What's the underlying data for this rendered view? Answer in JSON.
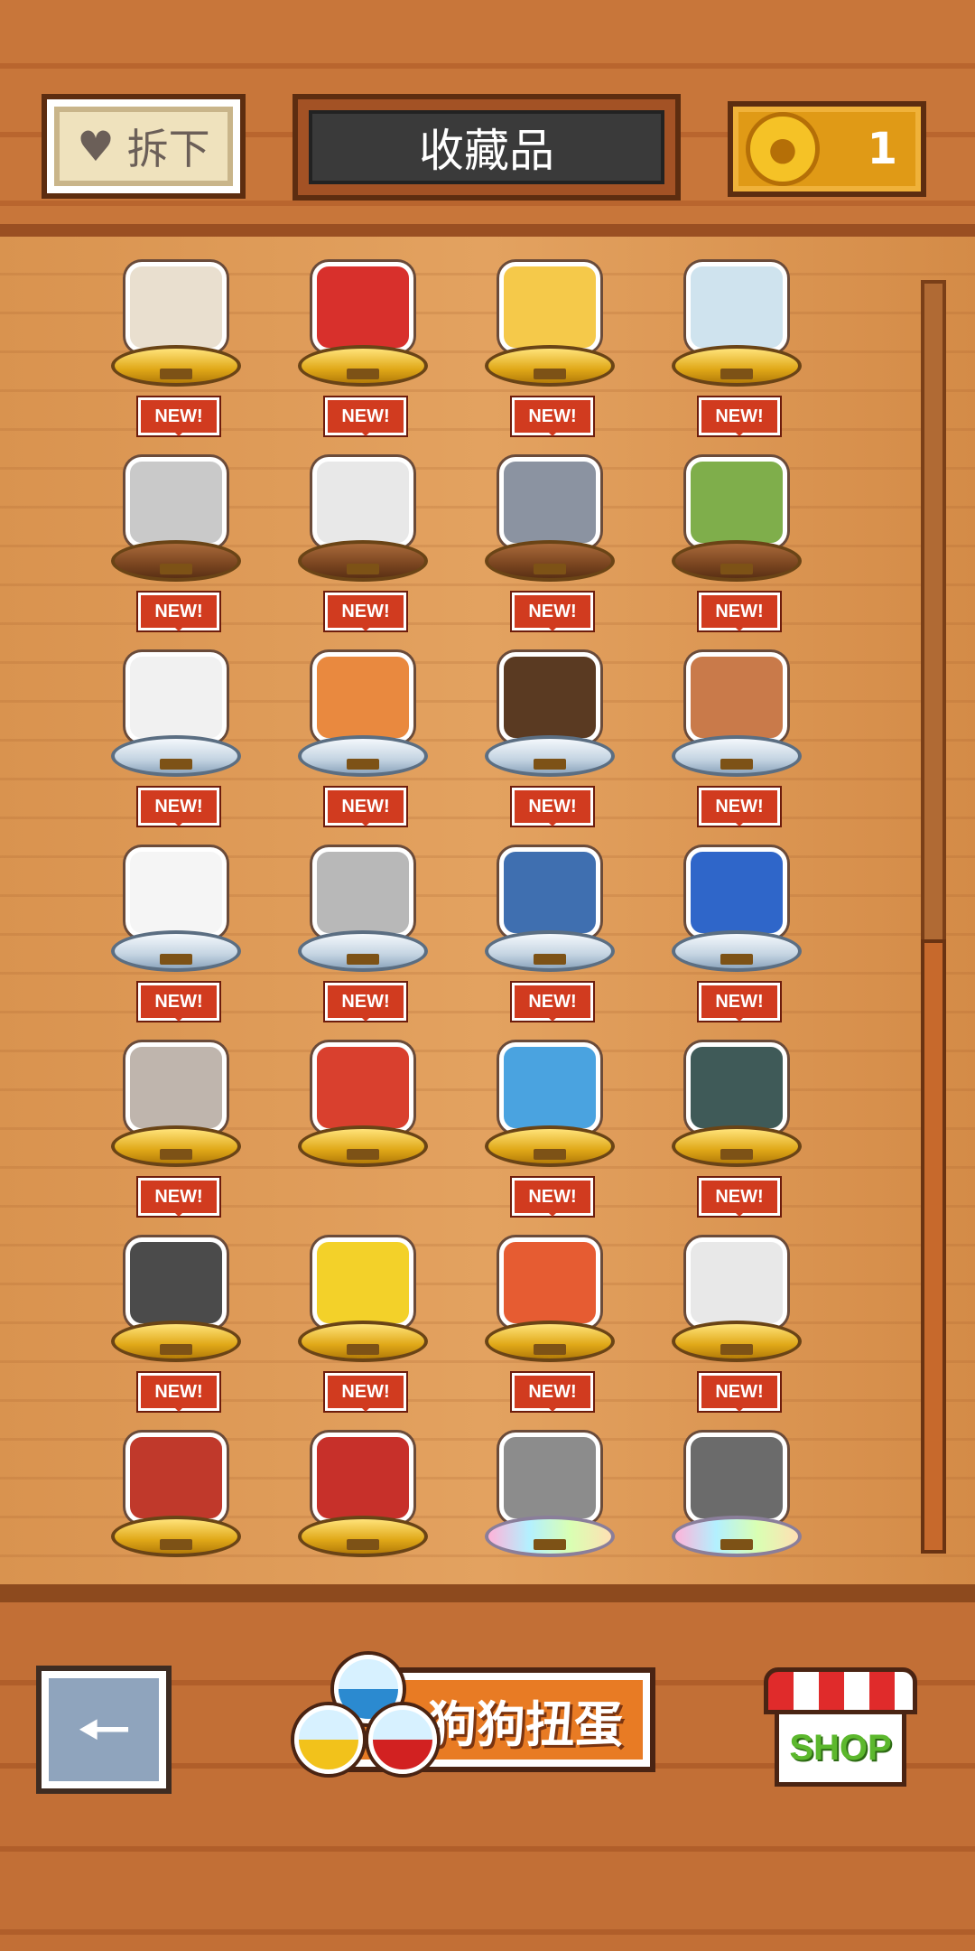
{
  "header": {
    "remove_label": "拆下",
    "title": "收藏品",
    "coins": "1"
  },
  "grid": {
    "rows": [
      {
        "items": [
          {
            "new": false,
            "base": "gold",
            "color": "#e9dfcf"
          },
          {
            "new": false,
            "base": "gold",
            "color": "#d8302c"
          },
          {
            "new": false,
            "base": "gold",
            "color": "#f5c94a"
          },
          {
            "new": false,
            "base": "gold",
            "color": "#cfe3ee"
          }
        ]
      },
      {
        "items": [
          {
            "new": true,
            "base": "wood",
            "color": "#c9c9c9"
          },
          {
            "new": true,
            "base": "wood",
            "color": "#e8e8e8"
          },
          {
            "new": true,
            "base": "wood",
            "color": "#8b93a1"
          },
          {
            "new": true,
            "base": "wood",
            "color": "#7fae4b"
          }
        ]
      },
      {
        "items": [
          {
            "new": true,
            "base": "silver",
            "color": "#f1f1f1"
          },
          {
            "new": true,
            "base": "silver",
            "color": "#e9893f"
          },
          {
            "new": true,
            "base": "silver",
            "color": "#5a3a22"
          },
          {
            "new": true,
            "base": "silver",
            "color": "#c97a4a"
          }
        ]
      },
      {
        "items": [
          {
            "new": true,
            "base": "silver",
            "color": "#f5f5f5"
          },
          {
            "new": true,
            "base": "silver",
            "color": "#b8b8b8"
          },
          {
            "new": true,
            "base": "silver",
            "color": "#3f6fb0"
          },
          {
            "new": true,
            "base": "silver",
            "color": "#2f66c9"
          }
        ]
      },
      {
        "items": [
          {
            "new": true,
            "base": "gold",
            "color": "#bfb5ad"
          },
          {
            "new": true,
            "base": "gold",
            "color": "#d9402e"
          },
          {
            "new": true,
            "base": "gold",
            "color": "#4aa3e0"
          },
          {
            "new": true,
            "base": "gold",
            "color": "#3f5a58"
          }
        ]
      },
      {
        "items": [
          {
            "new": true,
            "base": "gold",
            "color": "#4b4b4b"
          },
          {
            "new": false,
            "base": "gold",
            "color": "#f3d129"
          },
          {
            "new": true,
            "base": "gold",
            "color": "#e65c32"
          },
          {
            "new": true,
            "base": "gold",
            "color": "#e8e8e8"
          }
        ]
      },
      {
        "items": [
          {
            "new": true,
            "base": "gold",
            "color": "#c0392b"
          },
          {
            "new": true,
            "base": "gold",
            "color": "#c7302a"
          },
          {
            "new": true,
            "base": "rainbow",
            "color": "#8c8c8c"
          },
          {
            "new": true,
            "base": "rainbow",
            "color": "#6b6b6b"
          }
        ]
      }
    ],
    "badge_text": "NEW!"
  },
  "footer": {
    "gacha_label": "狗狗扭蛋",
    "shop_label": "SHOP"
  }
}
